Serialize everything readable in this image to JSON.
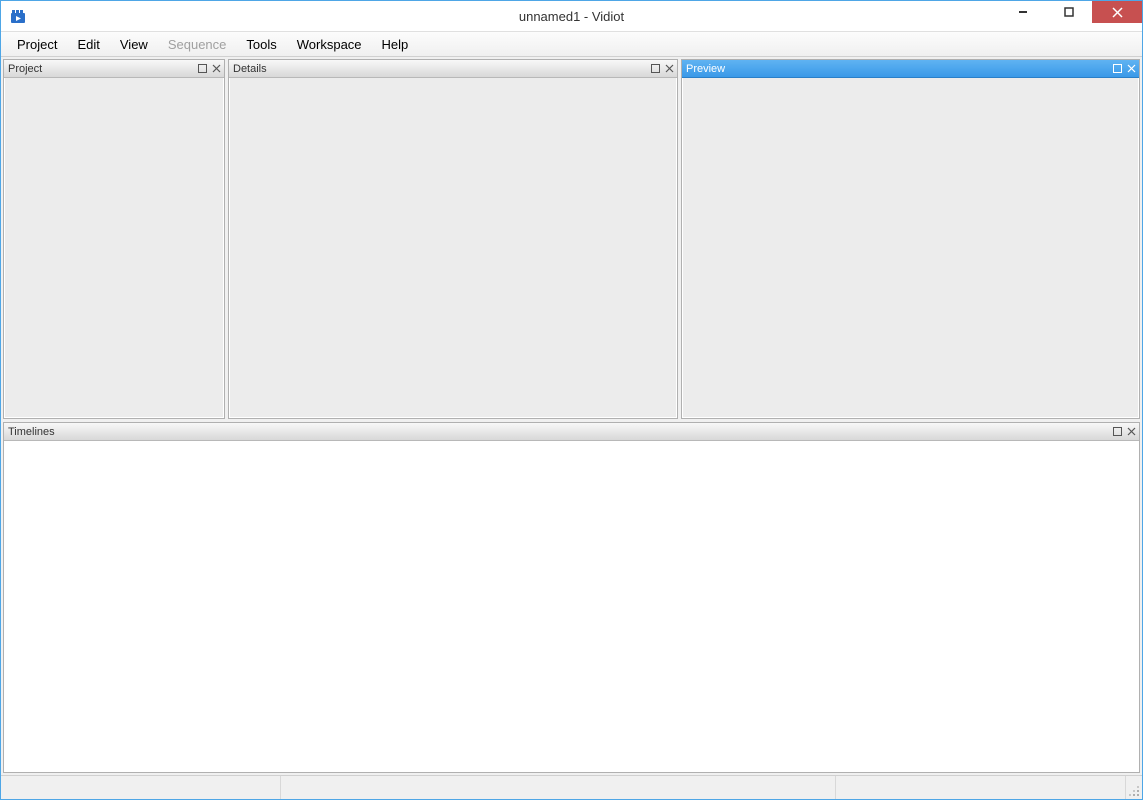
{
  "window": {
    "title": "unnamed1 - Vidiot"
  },
  "menubar": {
    "items": [
      {
        "label": "Project",
        "disabled": false
      },
      {
        "label": "Edit",
        "disabled": false
      },
      {
        "label": "View",
        "disabled": false
      },
      {
        "label": "Sequence",
        "disabled": true
      },
      {
        "label": "Tools",
        "disabled": false
      },
      {
        "label": "Workspace",
        "disabled": false
      },
      {
        "label": "Help",
        "disabled": false
      }
    ]
  },
  "panels": {
    "project": {
      "title": "Project",
      "active": false
    },
    "details": {
      "title": "Details",
      "active": false
    },
    "preview": {
      "title": "Preview",
      "active": true
    },
    "timelines": {
      "title": "Timelines",
      "active": false
    }
  }
}
